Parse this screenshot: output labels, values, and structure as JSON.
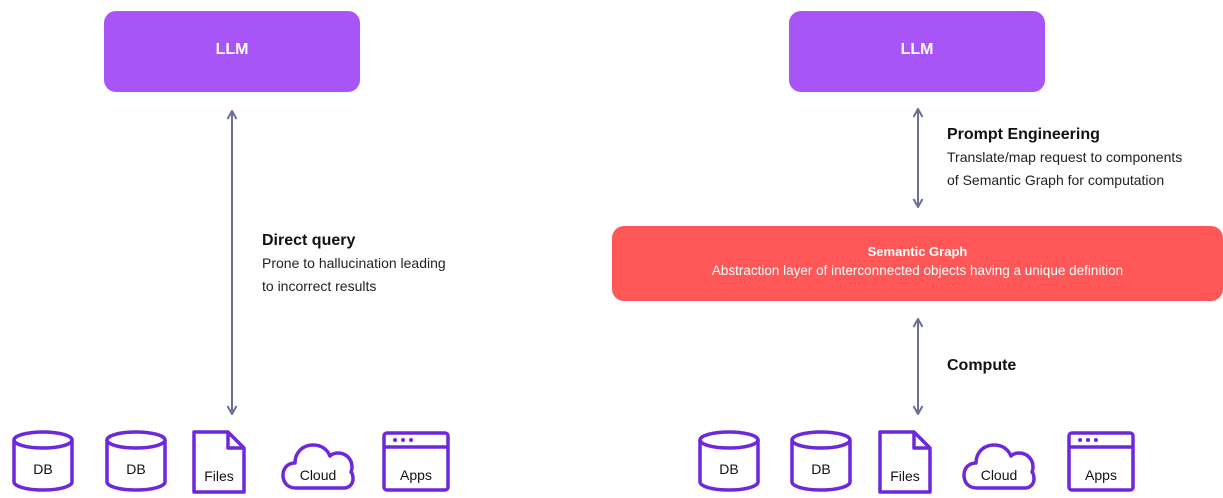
{
  "left_panel": {
    "llm_label": "LLM",
    "link": {
      "title": "Direct query",
      "desc_lines": [
        "Prone to hallucination leading",
        "to incorrect results"
      ]
    },
    "sources": [
      "DB",
      "DB",
      "Files",
      "Cloud",
      "Apps"
    ]
  },
  "right_panel": {
    "llm_label": "LLM",
    "top_link": {
      "title": "Prompt Engineering",
      "desc_lines": [
        "Translate/map request to components",
        "of Semantic Graph for computation"
      ]
    },
    "semantic_graph": {
      "title": "Semantic Graph",
      "desc": "Abstraction layer of interconnected objects having a unique definition"
    },
    "bottom_link": {
      "title": "Compute"
    },
    "sources": [
      "DB",
      "DB",
      "Files",
      "Cloud",
      "Apps"
    ]
  },
  "colors": {
    "llm_fill": "#a855f7",
    "semantic_fill": "#ff5757",
    "icon_stroke": "#6d28d9",
    "arrow": "#6b7094"
  },
  "icons": [
    "database-icon",
    "database-icon",
    "file-icon",
    "cloud-icon",
    "app-window-icon"
  ]
}
